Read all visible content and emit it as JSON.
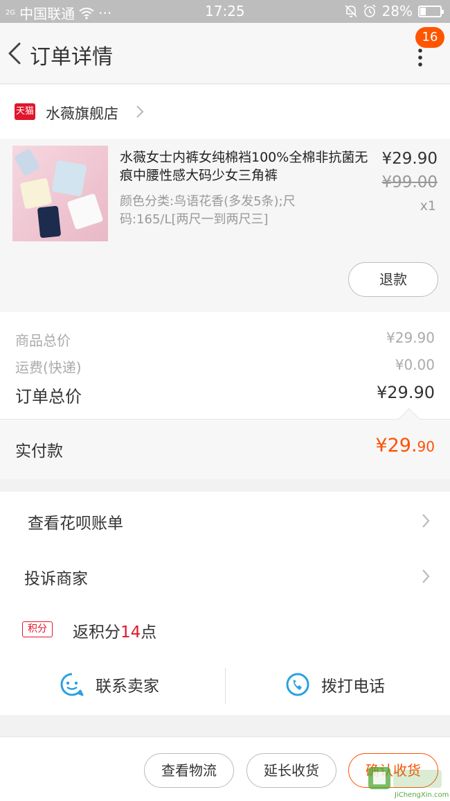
{
  "status_bar": {
    "signal": "2G",
    "carrier": "中国联通",
    "dots": "···",
    "time": "17:25",
    "battery": "28%",
    "battery_level": 0.28
  },
  "header": {
    "title": "订单详情",
    "badge_count": "16"
  },
  "shop": {
    "logo_text": "天猫",
    "name": "水薇旗舰店"
  },
  "product": {
    "title": "水薇女士内裤女纯棉裆100%全棉非抗菌无痕中腰性感大码少女三角裤",
    "sku": "颜色分类:鸟语花香(多发5条);尺码:165/L[两尺一到两尺三]",
    "price": "¥29.90",
    "original_price": "¥99.00",
    "quantity": "x1",
    "refund_button": "退款"
  },
  "summary": {
    "goods_total_label": "商品总价",
    "goods_total": "¥29.90",
    "shipping_label": "运费(快递)",
    "shipping": "¥0.00",
    "order_total_label": "订单总价",
    "order_total": "¥29.90"
  },
  "paid": {
    "label": "实付款",
    "amount_main": "¥29.",
    "amount_cents": "90"
  },
  "actions": {
    "huabei": "查看花呗账单",
    "complain": "投诉商家",
    "points_tag": "积分",
    "points_prefix": "返积分",
    "points_value": "14",
    "points_suffix": "点",
    "contact_seller": "联系卖家",
    "call": "拨打电话"
  },
  "bottom_bar": {
    "logistics": "查看物流",
    "extend": "延长收货",
    "confirm": "确认收货"
  },
  "watermark": {
    "text": "JiChengXin.com"
  },
  "colors": {
    "accent": "#ff5000",
    "tmall_red": "#e0162b",
    "icon_blue": "#2aa1e0"
  }
}
